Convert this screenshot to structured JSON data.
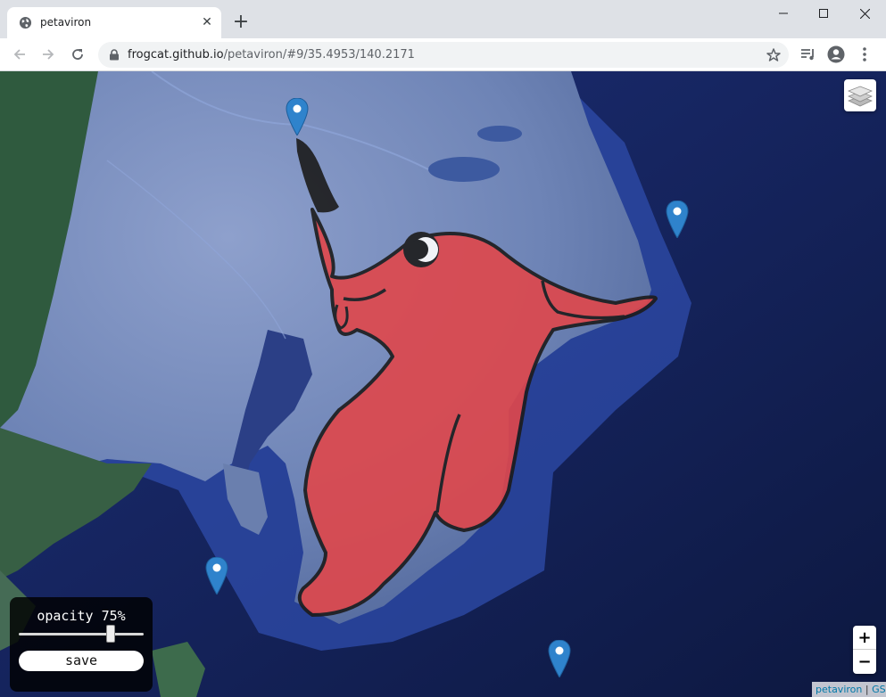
{
  "browser": {
    "tab": {
      "title": "petaviron",
      "favicon": "globe-icon"
    },
    "url": {
      "host": "frogcat.github.io",
      "path": "/petaviron/#9/35.4953/140.2171"
    }
  },
  "map": {
    "overlay": {
      "color": "#e0474b",
      "outline": "#1c1c1c"
    },
    "controls": {
      "zoom_in": "+",
      "zoom_out": "−",
      "layers_icon": "layers-icon"
    },
    "attribution": {
      "link1": "petaviron",
      "separator": " | ",
      "link2": "GSI"
    },
    "markers": [
      "marker",
      "marker",
      "marker",
      "marker"
    ]
  },
  "panel": {
    "opacity_label": "opacity 75%",
    "opacity_value": 0.75,
    "save_label": "save"
  },
  "colors": {
    "marker": "#2f83cc",
    "ocean": "#122257"
  }
}
